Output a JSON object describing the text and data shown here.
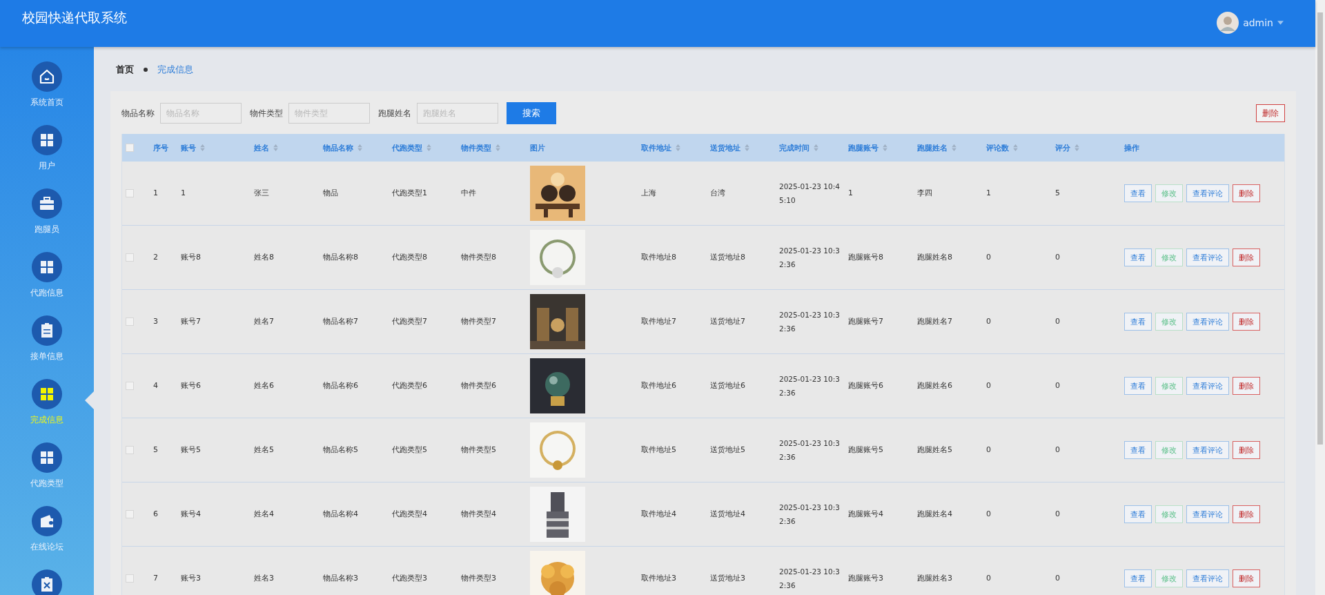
{
  "header": {
    "title": "校园快递代取系统",
    "user": "admin"
  },
  "sidebar": {
    "items": [
      {
        "label": "系统首页",
        "kind": "home",
        "selected": false
      },
      {
        "label": "用户",
        "kind": "grid",
        "selected": false
      },
      {
        "label": "跑腿员",
        "kind": "briefcase",
        "selected": false
      },
      {
        "label": "代跑信息",
        "kind": "grid",
        "selected": false
      },
      {
        "label": "接单信息",
        "kind": "clipboard",
        "selected": false
      },
      {
        "label": "完成信息",
        "kind": "grid",
        "selected": true
      },
      {
        "label": "代跑类型",
        "kind": "grid",
        "selected": false
      },
      {
        "label": "在线论坛",
        "kind": "wallet",
        "selected": false
      },
      {
        "kind": "cancel",
        "selected": false
      }
    ]
  },
  "breadcrumb": [
    "首页",
    "完成信息"
  ],
  "search": {
    "fields": [
      {
        "label": "物品名称",
        "placeholder": "物品名称"
      },
      {
        "label": "物件类型",
        "placeholder": "物件类型"
      },
      {
        "label": "跑腿姓名",
        "placeholder": "跑腿姓名"
      }
    ],
    "button": "搜索",
    "delete_button": "删除"
  },
  "table": {
    "header_checked": false,
    "columns": [
      {
        "label": "序号",
        "sortable": false
      },
      {
        "label": "账号",
        "sortable": true
      },
      {
        "label": "姓名",
        "sortable": true
      },
      {
        "label": "物品名称",
        "sortable": true
      },
      {
        "label": "代跑类型",
        "sortable": true
      },
      {
        "label": "物件类型",
        "sortable": true
      },
      {
        "label": "图片",
        "sortable": false
      },
      {
        "label": "取件地址",
        "sortable": true
      },
      {
        "label": "送货地址",
        "sortable": true
      },
      {
        "label": "完成时间",
        "sortable": true
      },
      {
        "label": "跑腿账号",
        "sortable": true
      },
      {
        "label": "跑腿姓名",
        "sortable": true
      },
      {
        "label": "评论数",
        "sortable": true
      },
      {
        "label": "评分",
        "sortable": true
      },
      {
        "label": "操作",
        "sortable": false
      }
    ],
    "rows": [
      {
        "checked": false,
        "cells": [
          "1",
          "1",
          "张三",
          "物品",
          "代跑类型1",
          "中件",
          "",
          "上海",
          "台湾",
          "2025-01-23 10:45:10",
          "1",
          "李四",
          "1",
          "5"
        ],
        "actions": [
          {
            "label": "查看",
            "kind": "view"
          },
          {
            "label": "修改",
            "kind": "edit"
          },
          {
            "label": "查看评论",
            "kind": "view"
          },
          {
            "label": "删除",
            "kind": "delete"
          }
        ]
      },
      {
        "checked": false,
        "cells": [
          "2",
          "账号8",
          "姓名8",
          "物品名称8",
          "代跑类型8",
          "物件类型8",
          "",
          "取件地址8",
          "送货地址8",
          "2025-01-23 10:32:36",
          "跑腿账号8",
          "跑腿姓名8",
          "0",
          "0"
        ],
        "actions": [
          {
            "label": "查看",
            "kind": "view"
          },
          {
            "label": "修改",
            "kind": "edit"
          },
          {
            "label": "查看评论",
            "kind": "view"
          },
          {
            "label": "删除",
            "kind": "delete"
          }
        ]
      },
      {
        "checked": false,
        "cells": [
          "3",
          "账号7",
          "姓名7",
          "物品名称7",
          "代跑类型7",
          "物件类型7",
          "",
          "取件地址7",
          "送货地址7",
          "2025-01-23 10:32:36",
          "跑腿账号7",
          "跑腿姓名7",
          "0",
          "0"
        ],
        "actions": [
          {
            "label": "查看",
            "kind": "view"
          },
          {
            "label": "修改",
            "kind": "edit"
          },
          {
            "label": "查看评论",
            "kind": "view"
          },
          {
            "label": "删除",
            "kind": "delete"
          }
        ]
      },
      {
        "checked": false,
        "cells": [
          "4",
          "账号6",
          "姓名6",
          "物品名称6",
          "代跑类型6",
          "物件类型6",
          "",
          "取件地址6",
          "送货地址6",
          "2025-01-23 10:32:36",
          "跑腿账号6",
          "跑腿姓名6",
          "0",
          "0"
        ],
        "actions": [
          {
            "label": "查看",
            "kind": "view"
          },
          {
            "label": "修改",
            "kind": "edit"
          },
          {
            "label": "查看评论",
            "kind": "view"
          },
          {
            "label": "删除",
            "kind": "delete"
          }
        ]
      },
      {
        "checked": false,
        "cells": [
          "5",
          "账号5",
          "姓名5",
          "物品名称5",
          "代跑类型5",
          "物件类型5",
          "",
          "取件地址5",
          "送货地址5",
          "2025-01-23 10:32:36",
          "跑腿账号5",
          "跑腿姓名5",
          "0",
          "0"
        ],
        "actions": [
          {
            "label": "查看",
            "kind": "view"
          },
          {
            "label": "修改",
            "kind": "edit"
          },
          {
            "label": "查看评论",
            "kind": "view"
          },
          {
            "label": "删除",
            "kind": "delete"
          }
        ]
      },
      {
        "checked": false,
        "cells": [
          "6",
          "账号4",
          "姓名4",
          "物品名称4",
          "代跑类型4",
          "物件类型4",
          "",
          "取件地址4",
          "送货地址4",
          "2025-01-23 10:32:36",
          "跑腿账号4",
          "跑腿姓名4",
          "0",
          "0"
        ],
        "actions": [
          {
            "label": "查看",
            "kind": "view"
          },
          {
            "label": "修改",
            "kind": "edit"
          },
          {
            "label": "查看评论",
            "kind": "view"
          },
          {
            "label": "删除",
            "kind": "delete"
          }
        ]
      },
      {
        "checked": false,
        "cells": [
          "7",
          "账号3",
          "姓名3",
          "物品名称3",
          "代跑类型3",
          "物件类型3",
          "",
          "取件地址3",
          "送货地址3",
          "2025-01-23 10:32:36",
          "跑腿账号3",
          "跑腿姓名3",
          "0",
          "0"
        ],
        "actions": [
          {
            "label": "查看",
            "kind": "view"
          },
          {
            "label": "修改",
            "kind": "edit"
          },
          {
            "label": "查看评论",
            "kind": "view"
          },
          {
            "label": "删除",
            "kind": "delete"
          }
        ]
      }
    ]
  }
}
